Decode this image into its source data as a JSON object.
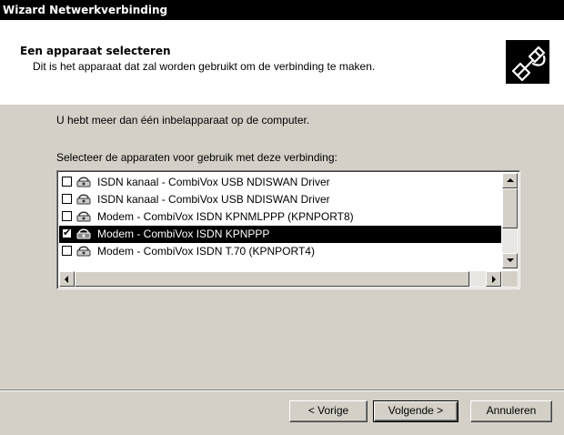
{
  "window": {
    "title": "Wizard Netwerkverbinding"
  },
  "header": {
    "title": "Een apparaat selecteren",
    "subtitle": "Dit is het apparaat dat zal worden gebruikt om de verbinding te maken.",
    "icon": "phone-cable-icon"
  },
  "body": {
    "intro": "U hebt meer dan één inbelapparaat op de computer.",
    "select_label": "Selecteer de apparaten voor gebruik met deze verbinding:"
  },
  "devices": [
    {
      "label": "ISDN  kanaal - CombiVox USB NDISWAN Driver",
      "checked": false,
      "selected": false
    },
    {
      "label": "ISDN  kanaal - CombiVox USB NDISWAN Driver",
      "checked": false,
      "selected": false
    },
    {
      "label": "Modem - CombiVox ISDN KPNMLPPP (KPNPORT8)",
      "checked": false,
      "selected": false
    },
    {
      "label": "Modem - CombiVox ISDN KPNPPP",
      "checked": true,
      "selected": true
    },
    {
      "label": "Modem - CombiVox ISDN T.70 (KPNPORT4)",
      "checked": false,
      "selected": false
    }
  ],
  "buttons": {
    "back": "< Vorige",
    "next": "Volgende >",
    "cancel": "Annuleren"
  }
}
